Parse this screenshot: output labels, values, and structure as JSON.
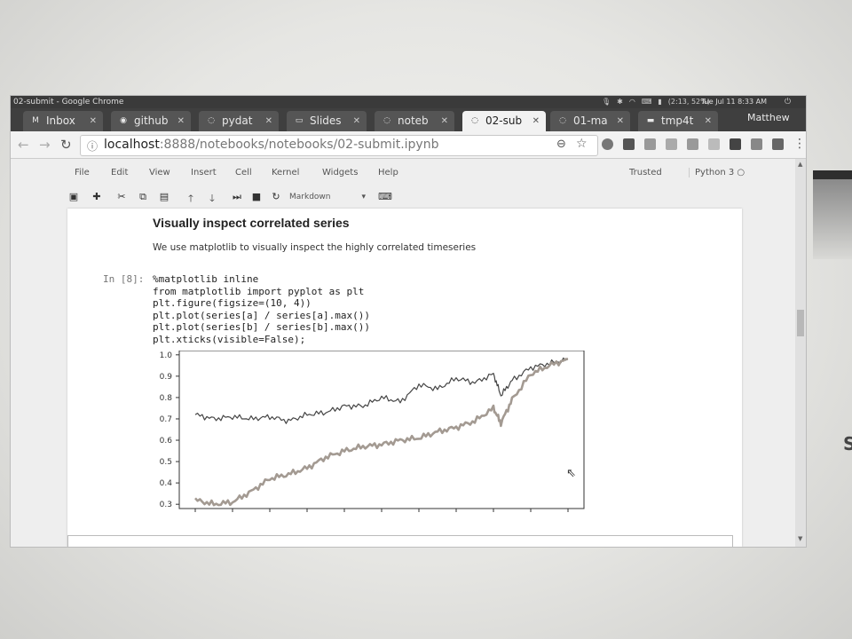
{
  "window": {
    "title": "02-submit - Google Chrome",
    "clock": "Tue Jul 11  8:33 AM",
    "battery": "(2:13, 52%)"
  },
  "tabs": [
    {
      "label": "Inbox",
      "icon": "gmail-icon",
      "active": false
    },
    {
      "label": "github",
      "icon": "github-icon",
      "active": false
    },
    {
      "label": "pydat",
      "icon": "pydata-icon",
      "active": false
    },
    {
      "label": "Slides",
      "icon": "slides-icon",
      "active": false
    },
    {
      "label": "noteb",
      "icon": "jupyter-icon",
      "active": false
    },
    {
      "label": "02-sub",
      "icon": "jupyter-icon",
      "active": true
    },
    {
      "label": "01-ma",
      "icon": "jupyter-icon",
      "active": false
    },
    {
      "label": "tmp4t",
      "icon": "folder-icon",
      "active": false
    }
  ],
  "profile": {
    "name": "Matthew"
  },
  "address": {
    "host": "localhost",
    "port_path": ":8888/notebooks/notebooks/02-submit.ipynb"
  },
  "jupyter": {
    "menu": [
      "File",
      "Edit",
      "View",
      "Insert",
      "Cell",
      "Kernel",
      "Widgets",
      "Help"
    ],
    "trusted": "Trusted",
    "kernel": "Python 3",
    "cell_type": "Markdown"
  },
  "cells": {
    "heading": "Visually inspect correlated series",
    "markdown": "We use matplotlib to visually inspect the highly correlated timeseries",
    "prompt": "In [8]:",
    "code": "%matplotlib inline\nfrom matplotlib import pyplot as plt\nplt.figure(figsize=(10, 4))\nplt.plot(series[a] / series[a].max())\nplt.plot(series[b] / series[b].max())\nplt.xticks(visible=False);"
  },
  "colors": {
    "series_a": "#444444",
    "series_b": "#a39a92",
    "accent_tab": "#f2f2f2"
  },
  "chart_data": {
    "type": "line",
    "xlabel": "",
    "ylabel": "",
    "ylim": [
      0.28,
      1.02
    ],
    "yticks": [
      "1.0",
      "0.9",
      "0.8",
      "0.7",
      "0.6",
      "0.5",
      "0.4",
      "0.3"
    ],
    "xticks_visible": false,
    "grid": false,
    "series": [
      {
        "x": [
          0.0,
          0.05,
          0.1,
          0.15,
          0.2,
          0.25,
          0.3,
          0.35,
          0.4,
          0.45,
          0.5,
          0.55,
          0.6,
          0.65,
          0.7,
          0.75,
          0.8,
          0.82,
          0.85,
          0.9,
          0.95,
          1.0
        ],
        "values": [
          0.72,
          0.7,
          0.71,
          0.7,
          0.71,
          0.69,
          0.72,
          0.73,
          0.76,
          0.76,
          0.8,
          0.78,
          0.86,
          0.84,
          0.89,
          0.87,
          0.91,
          0.81,
          0.88,
          0.94,
          0.96,
          0.98
        ]
      },
      {
        "x": [
          0.0,
          0.05,
          0.1,
          0.15,
          0.2,
          0.25,
          0.3,
          0.35,
          0.4,
          0.45,
          0.5,
          0.55,
          0.6,
          0.65,
          0.7,
          0.75,
          0.8,
          0.82,
          0.85,
          0.9,
          0.95,
          1.0
        ],
        "values": [
          0.32,
          0.3,
          0.31,
          0.36,
          0.42,
          0.44,
          0.47,
          0.52,
          0.55,
          0.57,
          0.58,
          0.6,
          0.61,
          0.64,
          0.66,
          0.69,
          0.75,
          0.68,
          0.79,
          0.91,
          0.95,
          0.98
        ]
      }
    ]
  }
}
